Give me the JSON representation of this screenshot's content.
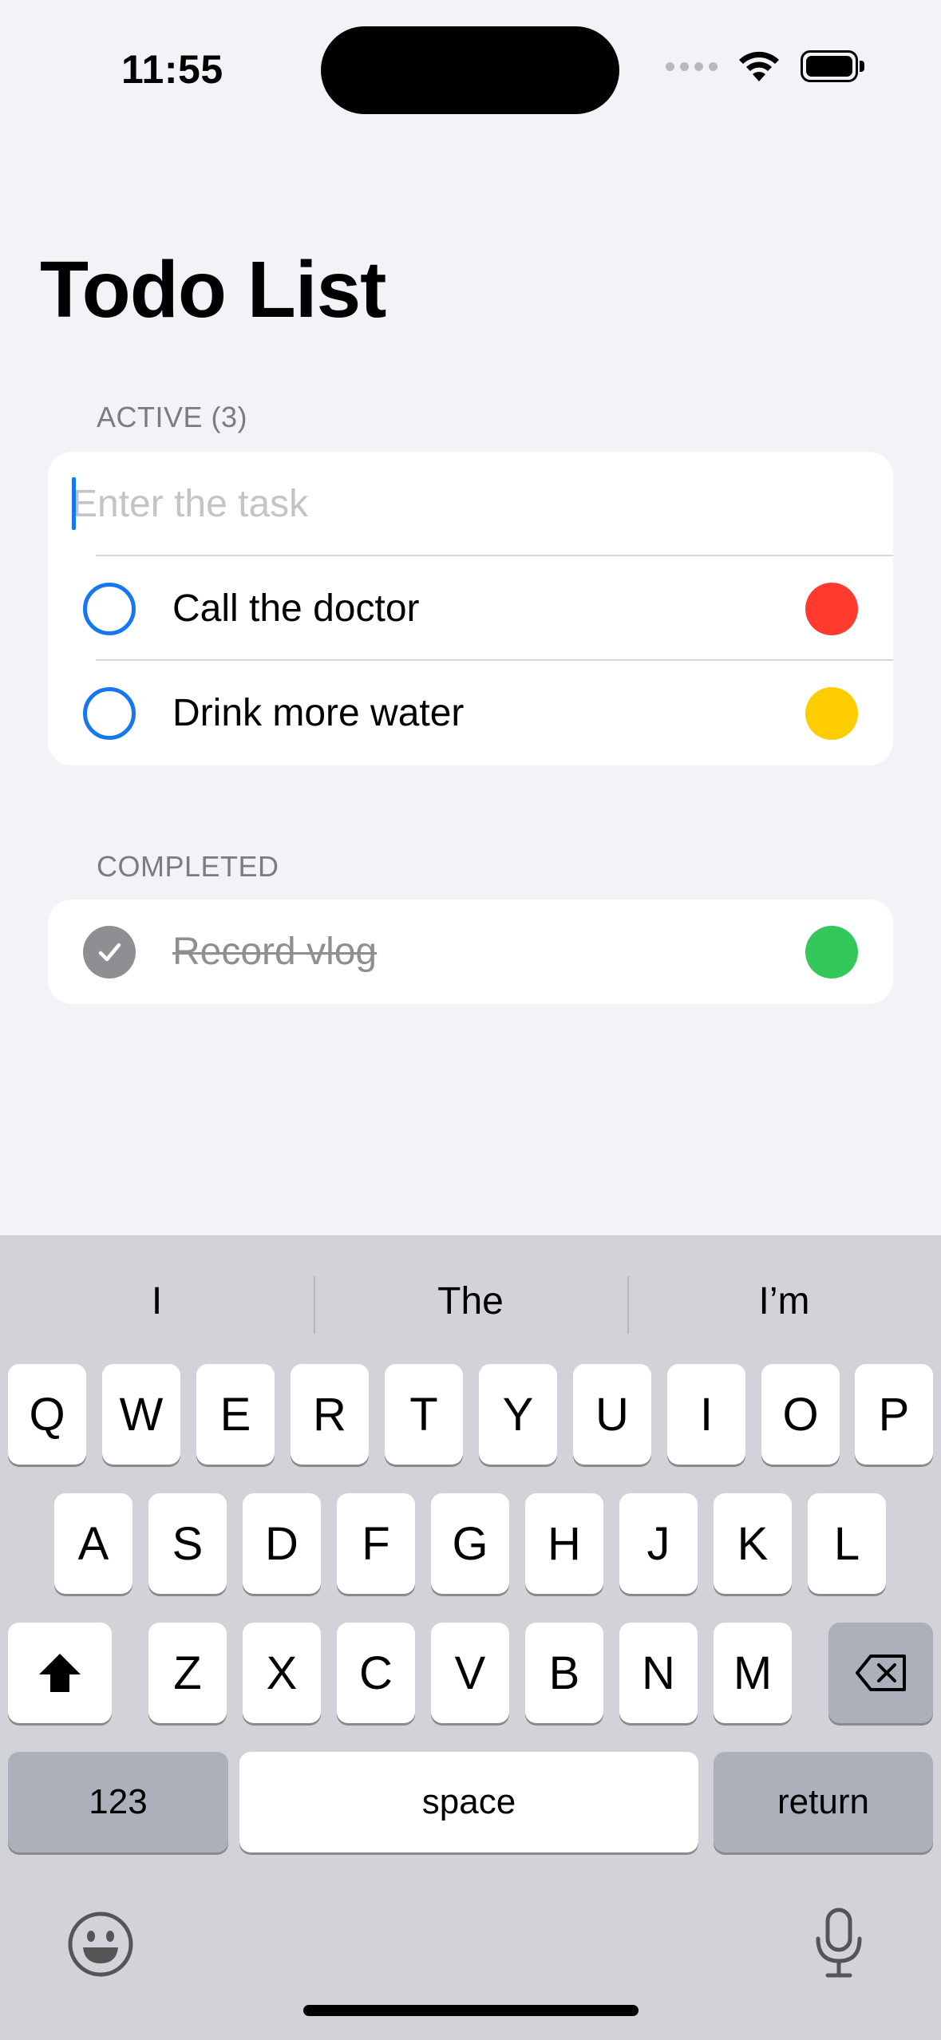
{
  "status_bar": {
    "time": "11:55"
  },
  "page": {
    "title": "Todo List"
  },
  "active_section": {
    "header": "ACTIVE (3)",
    "input_placeholder": "Enter the task",
    "tasks": [
      {
        "title": "Call the doctor",
        "priority_color": "#ff3b30"
      },
      {
        "title": "Drink more water",
        "priority_color": "#ffcc00"
      }
    ]
  },
  "completed_section": {
    "header": "COMPLETED",
    "tasks": [
      {
        "title": "Record vlog",
        "priority_color": "#34c759"
      }
    ]
  },
  "colors": {
    "accent": "#1677f3",
    "background": "#f2f2f7"
  },
  "keyboard": {
    "suggestions": [
      "I",
      "The",
      "I’m"
    ],
    "row1": [
      "Q",
      "W",
      "E",
      "R",
      "T",
      "Y",
      "U",
      "I",
      "O",
      "P"
    ],
    "row2": [
      "A",
      "S",
      "D",
      "F",
      "G",
      "H",
      "J",
      "K",
      "L"
    ],
    "row3": [
      "Z",
      "X",
      "C",
      "V",
      "B",
      "N",
      "M"
    ],
    "numbers_label": "123",
    "space_label": "space",
    "return_label": "return"
  }
}
